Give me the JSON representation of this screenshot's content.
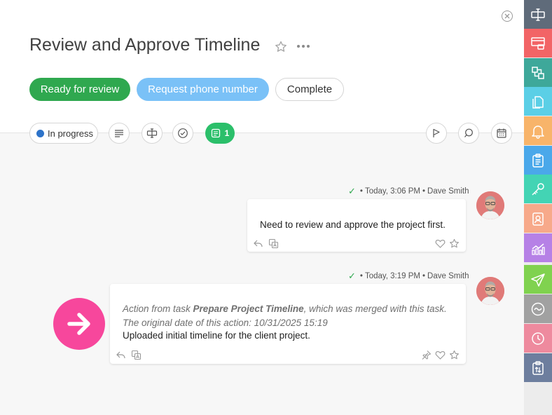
{
  "header": {
    "title": "Review and Approve Timeline"
  },
  "actions": {
    "ready_label": "Ready for review",
    "phone_label": "Request phone number",
    "complete_label": "Complete"
  },
  "toolbar": {
    "status_label": "In progress",
    "comment_count": "1"
  },
  "messages": [
    {
      "time": "Today, 3:06 PM",
      "author": "Dave Smith",
      "text": "Need to review and approve the project first."
    },
    {
      "time": "Today, 3:19 PM",
      "author": "Dave Smith",
      "action_prefix": "Action from task ",
      "action_task": "Prepare Project Timeline",
      "action_suffix": ", which was merged with this task.",
      "original_date": "The original date of this action: 10/31/2025 15:19",
      "text": "Uploaded initial timeline for the client project."
    }
  ],
  "sidebar": {
    "items": [
      {
        "icon": "text-cursor-icon",
        "color": "#5f6b7a"
      },
      {
        "icon": "window-icon",
        "color": "#f26466"
      },
      {
        "icon": "layers-icon",
        "color": "#3ea89a"
      },
      {
        "icon": "document-icon",
        "color": "#5bcfe6"
      },
      {
        "icon": "bell-icon",
        "color": "#f8b46a"
      },
      {
        "icon": "clipboard-icon",
        "color": "#4aa8ea"
      },
      {
        "icon": "key-icon",
        "color": "#43d4b4"
      },
      {
        "icon": "contact-icon",
        "color": "#f7a98a"
      },
      {
        "icon": "chart-icon",
        "color": "#b681e6"
      },
      {
        "icon": "send-icon",
        "color": "#80d24f"
      },
      {
        "icon": "wave-icon",
        "color": "#a1a1a1"
      },
      {
        "icon": "clock-icon",
        "color": "#ee8a9e"
      },
      {
        "icon": "upload-icon",
        "color": "#6d7e9e"
      }
    ]
  }
}
